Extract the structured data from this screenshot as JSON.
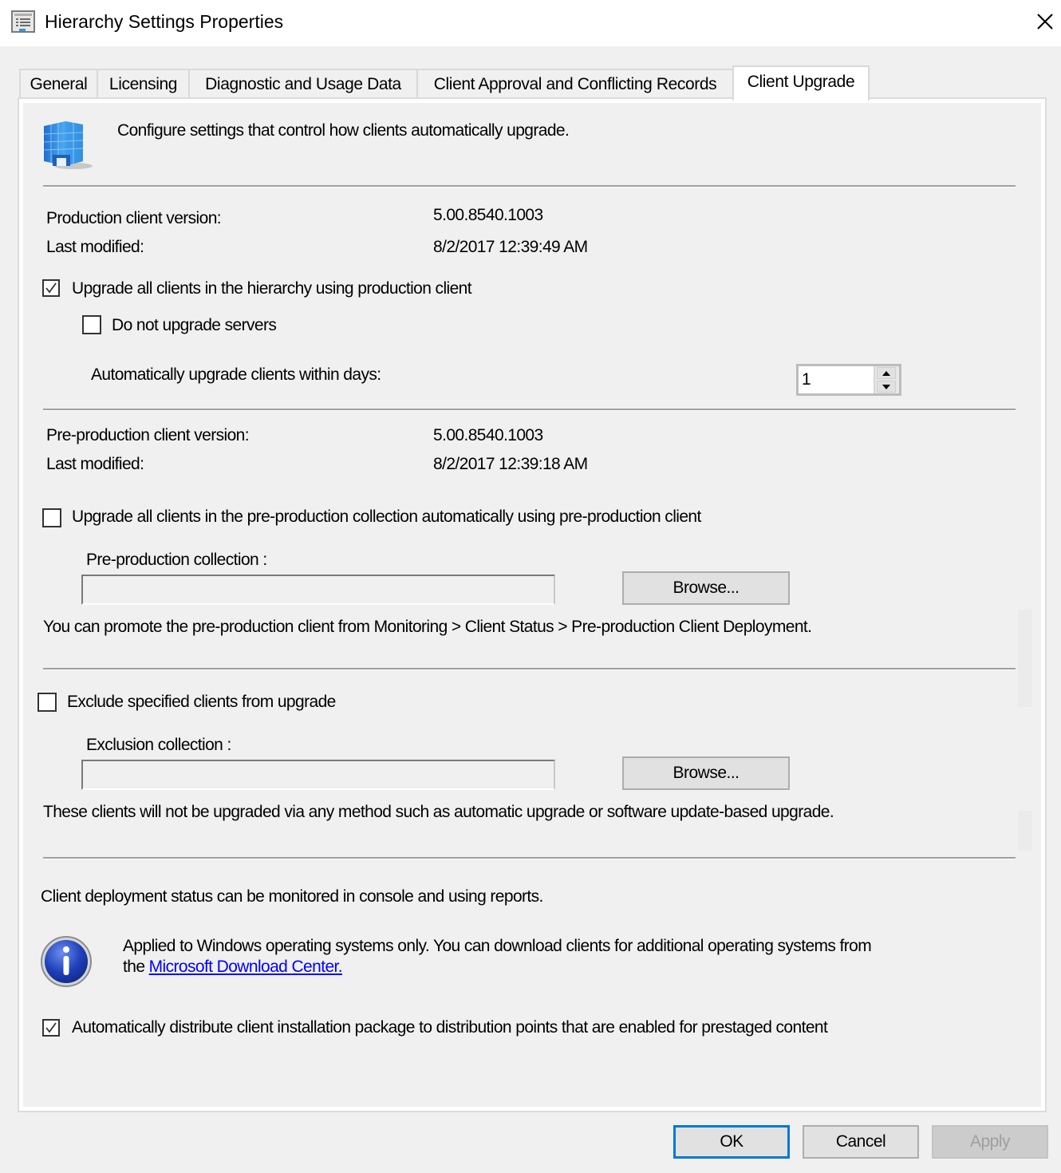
{
  "window": {
    "title": "Hierarchy Settings Properties",
    "icon": "properties-icon",
    "close_icon": "close-icon"
  },
  "tabs": [
    {
      "label": "General",
      "active": false
    },
    {
      "label": "Licensing",
      "active": false
    },
    {
      "label": "Diagnostic and Usage Data",
      "active": false
    },
    {
      "label": "Client Approval and Conflicting Records",
      "active": false
    },
    {
      "label": "Client Upgrade",
      "active": true
    }
  ],
  "header": {
    "icon": "building-icon",
    "description": "Configure settings that control how clients automatically upgrade."
  },
  "production": {
    "version_label": "Production client version:",
    "version_value": "5.00.8540.1003",
    "modified_label": "Last modified:",
    "modified_value": "8/2/2017 12:39:49 AM",
    "upgrade_all": {
      "label": "Upgrade all clients in the hierarchy using production client",
      "checked": true
    },
    "no_servers": {
      "label": "Do not upgrade servers",
      "checked": false
    },
    "days_label": "Automatically upgrade clients within days:",
    "days_value": "1"
  },
  "preproduction": {
    "version_label": "Pre-production client version:",
    "version_value": "5.00.8540.1003",
    "modified_label": "Last modified:",
    "modified_value": "8/2/2017 12:39:18 AM",
    "upgrade_all": {
      "label": "Upgrade all clients in the pre-production collection automatically using pre-production client",
      "checked": false
    },
    "collection_label": "Pre-production collection :",
    "collection_value": "",
    "browse_label": "Browse...",
    "note": "You can promote the pre-production client from Monitoring > Client Status > Pre-production Client Deployment."
  },
  "exclusion": {
    "checkbox": {
      "label": "Exclude specified clients from upgrade",
      "checked": false
    },
    "collection_label": "Exclusion collection :",
    "collection_value": "",
    "browse_label": "Browse...",
    "note": "These clients will not be upgraded via any method such as automatic upgrade or software update-based upgrade."
  },
  "status_note": "Client deployment status can be monitored in console and using reports.",
  "info": {
    "icon": "info-icon",
    "text_before": "Applied to Windows operating systems only. You can download clients for additional operating systems from",
    "text_the": "the ",
    "link_text": "Microsoft Download Center."
  },
  "distribute": {
    "label": "Automatically distribute client installation package to distribution points that are enabled for prestaged content",
    "checked": true
  },
  "footer": {
    "ok_label": "OK",
    "cancel_label": "Cancel",
    "apply_label": "Apply",
    "apply_enabled": false
  },
  "colors": {
    "accent_focus": "#0078d7",
    "link": "#0000ff",
    "dialog_bg": "#f0f0f0"
  }
}
